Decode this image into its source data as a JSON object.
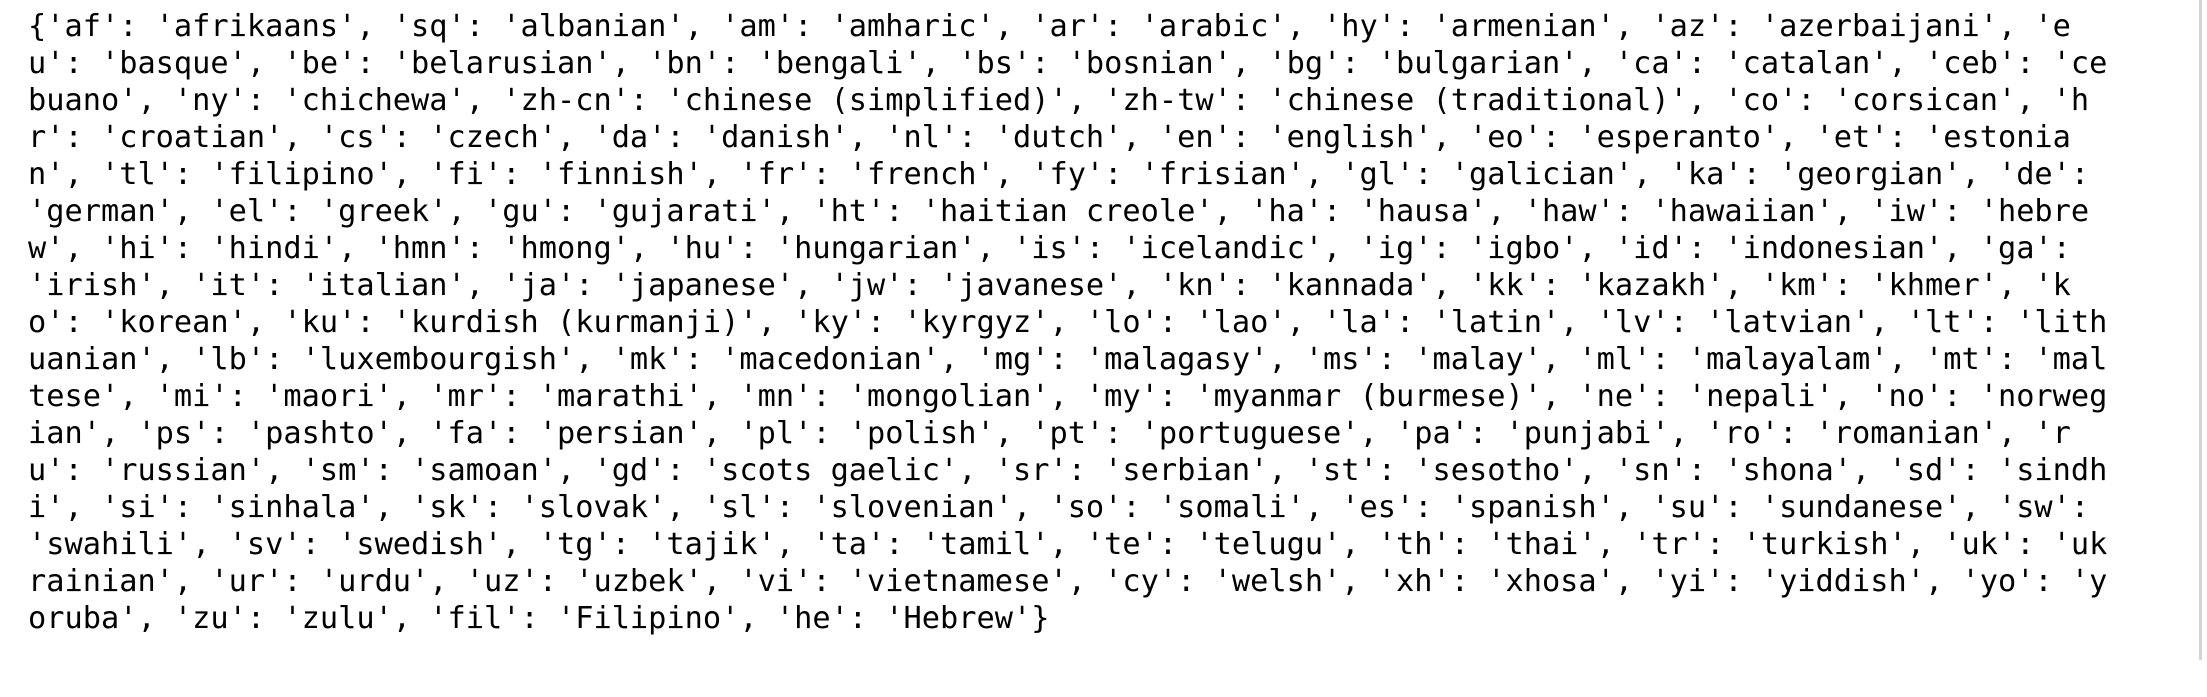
{
  "output": {
    "lines": [
      "{'af': 'afrikaans', 'sq': 'albanian', 'am': 'amharic', 'ar': 'arabic', 'hy': 'armenian', 'az': 'azerbaijani', 'e",
      "u': 'basque', 'be': 'belarusian', 'bn': 'bengali', 'bs': 'bosnian', 'bg': 'bulgarian', 'ca': 'catalan', 'ceb': 'ce",
      "buano', 'ny': 'chichewa', 'zh-cn': 'chinese (simplified)', 'zh-tw': 'chinese (traditional)', 'co': 'corsican', 'h",
      "r': 'croatian', 'cs': 'czech', 'da': 'danish', 'nl': 'dutch', 'en': 'english', 'eo': 'esperanto', 'et': 'estonia",
      "n', 'tl': 'filipino', 'fi': 'finnish', 'fr': 'french', 'fy': 'frisian', 'gl': 'galician', 'ka': 'georgian', 'de':",
      "'german', 'el': 'greek', 'gu': 'gujarati', 'ht': 'haitian creole', 'ha': 'hausa', 'haw': 'hawaiian', 'iw': 'hebre",
      "w', 'hi': 'hindi', 'hmn': 'hmong', 'hu': 'hungarian', 'is': 'icelandic', 'ig': 'igbo', 'id': 'indonesian', 'ga':",
      "'irish', 'it': 'italian', 'ja': 'japanese', 'jw': 'javanese', 'kn': 'kannada', 'kk': 'kazakh', 'km': 'khmer', 'k",
      "o': 'korean', 'ku': 'kurdish (kurmanji)', 'ky': 'kyrgyz', 'lo': 'lao', 'la': 'latin', 'lv': 'latvian', 'lt': 'lith",
      "uanian', 'lb': 'luxembourgish', 'mk': 'macedonian', 'mg': 'malagasy', 'ms': 'malay', 'ml': 'malayalam', 'mt': 'mal",
      "tese', 'mi': 'maori', 'mr': 'marathi', 'mn': 'mongolian', 'my': 'myanmar (burmese)', 'ne': 'nepali', 'no': 'norweg",
      "ian', 'ps': 'pashto', 'fa': 'persian', 'pl': 'polish', 'pt': 'portuguese', 'pa': 'punjabi', 'ro': 'romanian', 'r",
      "u': 'russian', 'sm': 'samoan', 'gd': 'scots gaelic', 'sr': 'serbian', 'st': 'sesotho', 'sn': 'shona', 'sd': 'sindh",
      "i', 'si': 'sinhala', 'sk': 'slovak', 'sl': 'slovenian', 'so': 'somali', 'es': 'spanish', 'su': 'sundanese', 'sw':",
      "'swahili', 'sv': 'swedish', 'tg': 'tajik', 'ta': 'tamil', 'te': 'telugu', 'th': 'thai', 'tr': 'turkish', 'uk': 'uk",
      "rainian', 'ur': 'urdu', 'uz': 'uzbek', 'vi': 'vietnamese', 'cy': 'welsh', 'xh': 'xhosa', 'yi': 'yiddish', 'yo': 'y",
      "oruba', 'zu': 'zulu', 'fil': 'Filipino', 'he': 'Hebrew'}"
    ]
  }
}
